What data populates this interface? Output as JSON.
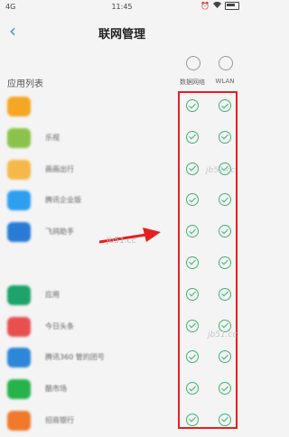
{
  "status_bar": {
    "signal": "4G",
    "time": "11:45"
  },
  "header": {
    "back_glyph": "‹",
    "title": "联网管理"
  },
  "columns": {
    "data": "数据网络",
    "wlan": "WLAN"
  },
  "section_label": "应用列表",
  "apps": [
    {
      "name": "",
      "color": "#f5a623"
    },
    {
      "name": "乐视",
      "color": "#8bc34a"
    },
    {
      "name": "画画出行",
      "color": "#f6b84a"
    },
    {
      "name": "腾讯企业版",
      "color": "#2e9ff0"
    },
    {
      "name": "飞鸽助手",
      "color": "#2a7bd6"
    },
    {
      "name": "",
      "color": "#f4f4f4"
    },
    {
      "name": "应用",
      "color": "#1ea36b"
    },
    {
      "name": "今日头条",
      "color": "#e85050"
    },
    {
      "name": "腾讯360 管的团号",
      "color": "#2d86d8"
    },
    {
      "name": "酷市场",
      "color": "#25b34a"
    },
    {
      "name": "招商银行",
      "color": "#f07a2a"
    }
  ],
  "watermark": "jb51.cc",
  "overlay_label": "Jb51.cc",
  "colors": {
    "accent": "#2a9fd6",
    "check": "#3cb371",
    "highlight": "#e52020"
  }
}
